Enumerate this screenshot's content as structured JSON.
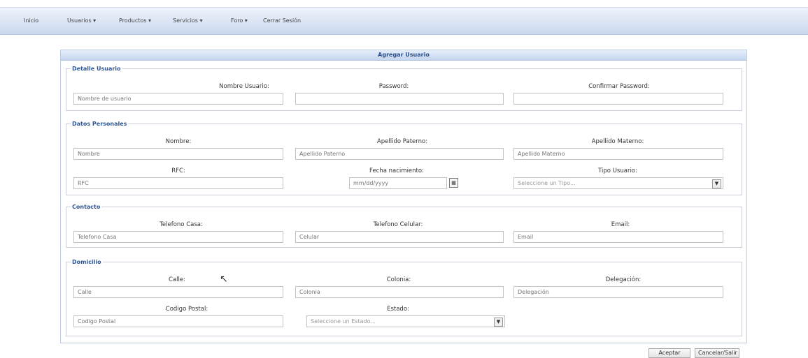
{
  "nav": {
    "items": [
      "Inicio",
      "Usuarios ▾",
      "Productos ▾",
      "Servicios ▾",
      "Foro ▾",
      "Cerrar Sesión"
    ]
  },
  "form": {
    "title": "Agregar Usuario",
    "sections": {
      "detalle": {
        "legend": "Detalle Usuario",
        "nombre_usuario_label": "Nombre Usuario:",
        "nombre_usuario_placeholder": "Nombre de usuario",
        "password_label": "Password:",
        "confirmar_password_label": "Confirmar Password:"
      },
      "personales": {
        "legend": "Datos Personales",
        "nombre_label": "Nombre:",
        "nombre_placeholder": "Nombre",
        "apellido_paterno_label": "Apellido Paterno:",
        "apellido_paterno_placeholder": "Apellido Paterno",
        "apellido_materno_label": "Apellido Materno:",
        "apellido_materno_placeholder": "Apellido Materno",
        "rfc_label": "RFC:",
        "rfc_placeholder": "RFC",
        "fecha_label": "Fecha nacimiento:",
        "fecha_placeholder": "mm/dd/yyyy",
        "tipo_usuario_label": "Tipo Usuario:",
        "tipo_usuario_value": "Seleccione un Tipo..."
      },
      "contacto": {
        "legend": "Contacto",
        "tel_casa_label": "Telefono Casa:",
        "tel_casa_placeholder": "Telefono Casa",
        "tel_celular_label": "Telefono Celular:",
        "tel_celular_placeholder": "Celular",
        "email_label": "Email:",
        "email_placeholder": "Email"
      },
      "domicilio": {
        "legend": "Domicilio",
        "calle_label": "Calle:",
        "calle_placeholder": "Calle",
        "colonia_label": "Colonia:",
        "colonia_placeholder": "Colonia",
        "delegacion_label": "Delegación:",
        "delegacion_placeholder": "Delegación",
        "cp_label": "Codigo Postal:",
        "cp_placeholder": "Codigo Postal",
        "estado_label": "Estado:",
        "estado_value": "Seleccione un Estado..."
      }
    }
  },
  "buttons": {
    "aceptar": "Aceptar",
    "cancelar": "Cancelar/Salir"
  }
}
